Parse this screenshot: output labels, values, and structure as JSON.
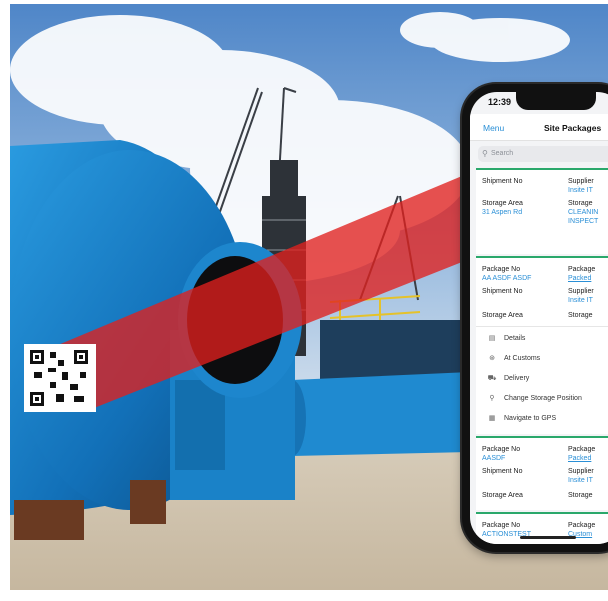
{
  "status": {
    "time": "12:39"
  },
  "navbar": {
    "menu_label": "Menu",
    "title": "Site Packages"
  },
  "search": {
    "placeholder": "Search"
  },
  "card1": {
    "shipment_label": "Shipment No",
    "supplier_label": "Supplier",
    "supplier_value": "Insite IT",
    "storage_area_label": "Storage Area",
    "storage_area_value": "31 Aspen Rd",
    "storage_label": "Storage",
    "status_value1": "CLEANIN",
    "status_value2": "INSPECT"
  },
  "card2": {
    "package_no_label": "Package No",
    "package_no_value": "AA ASDF ASDF",
    "package_label": "Package",
    "package_status": "Packed",
    "shipment_label": "Shipment No",
    "supplier_label": "Supplier",
    "supplier_value": "Insite IT",
    "storage_area_label": "Storage Area",
    "storage_label": "Storage",
    "menu": [
      {
        "icon": "document-icon",
        "glyph": "▤",
        "label": "Details"
      },
      {
        "icon": "customs-icon",
        "glyph": "⊛",
        "label": "At Customs"
      },
      {
        "icon": "truck-icon",
        "glyph": "⛟",
        "label": "Delivery"
      },
      {
        "icon": "location-pin-icon",
        "glyph": "⚲",
        "label": "Change Storage Position"
      },
      {
        "icon": "map-icon",
        "glyph": "▦",
        "label": "Navigate to GPS"
      }
    ]
  },
  "card3": {
    "package_no_label": "Package No",
    "package_no_value": "AASDF",
    "package_label": "Package",
    "package_status": "Packed",
    "shipment_label": "Shipment No",
    "supplier_label": "Supplier",
    "supplier_value": "Insite IT",
    "storage_area_label": "Storage Area",
    "storage_label": "Storage"
  },
  "card4": {
    "package_no_label": "Package No",
    "package_no_value": "ACTIONSTEST",
    "package_label": "Package",
    "package_status": "Custom"
  },
  "colors": {
    "accent": "#2a8fd6",
    "divider_green": "#2aa86b",
    "scan_beam": "#e0201e"
  }
}
